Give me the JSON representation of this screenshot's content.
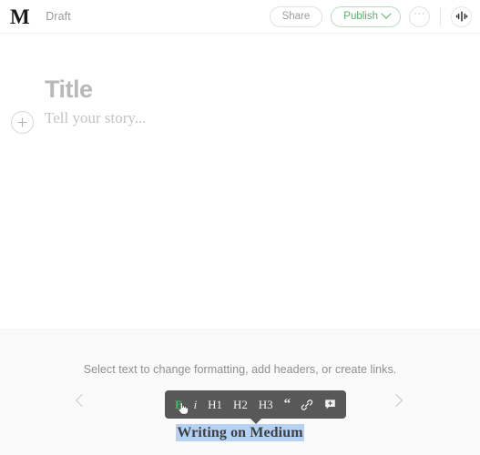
{
  "header": {
    "logo": "M",
    "logo_icon": "medium-m-logo",
    "status_label": "Draft",
    "share_label": "Share",
    "publish_label": "Publish",
    "publish_chevron_icon": "chevron-down-icon",
    "more_label": "···",
    "more_icon": "ellipsis-icon",
    "avatar_icon": "avatar-sparkle-icon",
    "publish_color": "#5bab6e",
    "border_color": "#ededed"
  },
  "editor": {
    "add_block_icon": "plus-circle-icon",
    "title_placeholder": "Title",
    "body_placeholder": "Tell your story...",
    "placeholder_color": "#b8b8b8"
  },
  "tip_panel": {
    "background": "#fafafa",
    "message": "Select text to change formatting, add headers, or create links.",
    "prev_icon": "chevron-left-icon",
    "next_icon": "chevron-right-icon"
  },
  "formatting_toolbar": {
    "background": "#585858",
    "active_color": "#3dbf62",
    "cursor_icon": "hand-pointer-cursor",
    "buttons": [
      {
        "id": "bold",
        "label": "B",
        "icon": "bold-icon",
        "active": true
      },
      {
        "id": "italic",
        "label": "i",
        "icon": "italic-icon",
        "active": false
      },
      {
        "id": "h1",
        "label": "H1",
        "icon": "heading-1-icon",
        "active": false
      },
      {
        "id": "h2",
        "label": "H2",
        "icon": "heading-2-icon",
        "active": false
      },
      {
        "id": "h3",
        "label": "H3",
        "icon": "heading-3-icon",
        "active": false
      },
      {
        "id": "blockquote",
        "label": "“",
        "icon": "quote-icon",
        "active": false
      },
      {
        "id": "link",
        "label": "",
        "icon": "link-icon",
        "active": false
      },
      {
        "id": "note",
        "label": "",
        "icon": "add-note-icon",
        "active": false
      }
    ]
  },
  "sample": {
    "selected_text": "Writing on Medium",
    "selection_color": "#b5d2f5"
  }
}
